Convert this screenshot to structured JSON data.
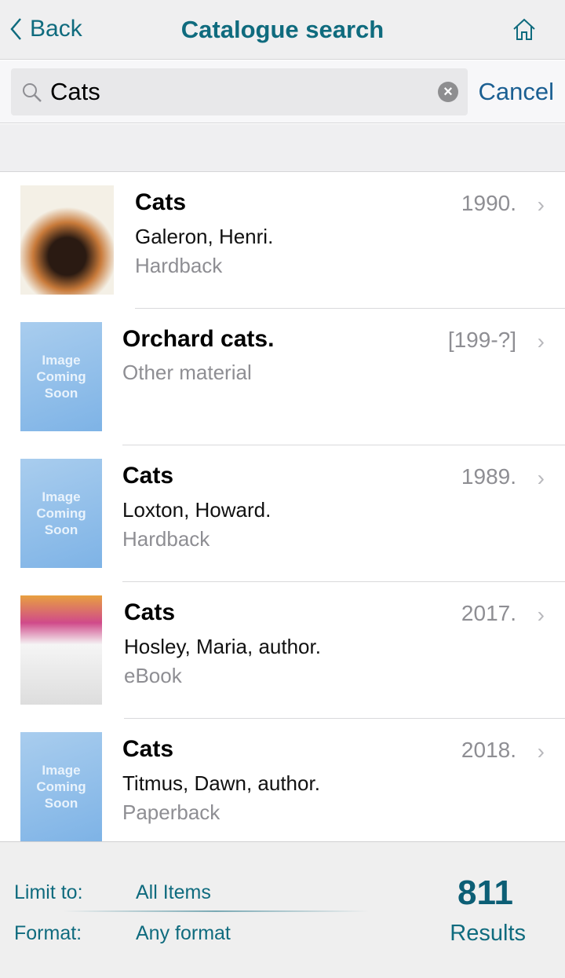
{
  "nav": {
    "back": "Back",
    "title": "Catalogue search"
  },
  "search": {
    "value": "Cats",
    "cancel": "Cancel"
  },
  "results": [
    {
      "title": "Cats",
      "author": "Galeron, Henri.",
      "format": "Hardback",
      "year": "1990.",
      "cover": "cover-image"
    },
    {
      "title": "Orchard cats.",
      "author": "",
      "format": "Other material",
      "year": "[199-?]",
      "cover": "Image Coming Soon"
    },
    {
      "title": "Cats",
      "author": "Loxton, Howard.",
      "format": "Hardback",
      "year": "1989.",
      "cover": "Image Coming Soon"
    },
    {
      "title": "Cats",
      "author": "Hosley, Maria, author.",
      "format": "eBook",
      "year": "2017.",
      "cover": "cover-image"
    },
    {
      "title": "Cats",
      "author": "Titmus, Dawn, author.",
      "format": "Paperback",
      "year": "2018.",
      "cover": "Image Coming Soon"
    }
  ],
  "footer": {
    "limit_label": "Limit to:",
    "limit_value": "All Items",
    "format_label": "Format:",
    "format_value": "Any format",
    "count": "811",
    "count_label": "Results"
  },
  "colors": {
    "accent": "#0f6b7e",
    "cancel": "#1b5f92"
  }
}
